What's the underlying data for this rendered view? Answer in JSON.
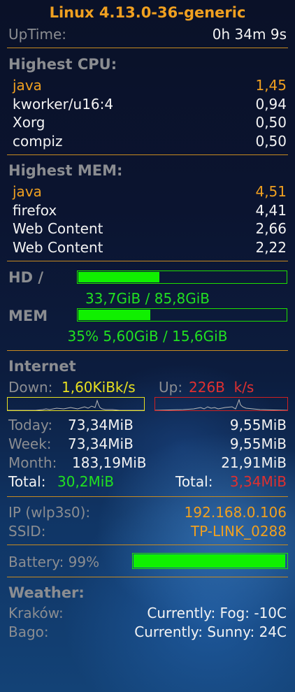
{
  "colors": {
    "accent": "#f0a020",
    "label_gray": "#8b8d91",
    "text_white": "#f3f3f3",
    "green": "#21e021",
    "bar_green": "#10f000",
    "yellow": "#e8e020",
    "red": "#e03030",
    "divider": "#c78a20"
  },
  "system": {
    "title": "Linux 4.13.0-36-generic",
    "uptime_label": "UpTime:",
    "uptime_value": "0h 34m 9s"
  },
  "cpu": {
    "header": "Highest CPU:",
    "procs": [
      {
        "name": "java",
        "value": "1,45"
      },
      {
        "name": "kworker/u16:4",
        "value": "0,94"
      },
      {
        "name": "Xorg",
        "value": "0,50"
      },
      {
        "name": "compiz",
        "value": "0,50"
      }
    ]
  },
  "mem": {
    "header": "Highest MEM:",
    "procs": [
      {
        "name": "java",
        "value": "4,51"
      },
      {
        "name": "firefox",
        "value": "4,41"
      },
      {
        "name": "Web Content",
        "value": "2,66"
      },
      {
        "name": "Web Content",
        "value": "2,22"
      }
    ]
  },
  "disk": {
    "label": "HD /",
    "usage": "33,7GiB / 85,8GiB",
    "fraction": 0.393
  },
  "memory": {
    "label": "MEM",
    "usage": "35% 5,60GiB / 15,6GiB",
    "fraction": 0.35
  },
  "internet": {
    "header": "Internet",
    "down_label": "Down:",
    "down_value": "1,60KiBk/s",
    "up_label": "Up:",
    "up_value": "226B  k/s",
    "rows": [
      {
        "label": "Today:",
        "down": "73,34MiB",
        "up": "9,55MiB"
      },
      {
        "label": "Week:",
        "down": "73,34MiB",
        "up": "9,55MiB"
      },
      {
        "label": "Month:",
        "down": "183,19MiB",
        "up": "21,91MiB"
      }
    ],
    "total_label": "Total:",
    "total_down": "30,2MiB",
    "total_up": "3,34MiB"
  },
  "network": {
    "ip_label": "IP (wlp3s0):",
    "ip_value": "192.168.0.106",
    "ssid_label": "SSID:",
    "ssid_value": "TP-LINK_0288"
  },
  "battery": {
    "label": "Battery: 99%",
    "fraction": 0.99
  },
  "weather": {
    "header": "Weather:",
    "cities": [
      {
        "name": "Kraków:",
        "value": "Currently: Fog: -10C"
      },
      {
        "name": "Bago:",
        "value": "Currently: Sunny: 24C"
      }
    ]
  }
}
